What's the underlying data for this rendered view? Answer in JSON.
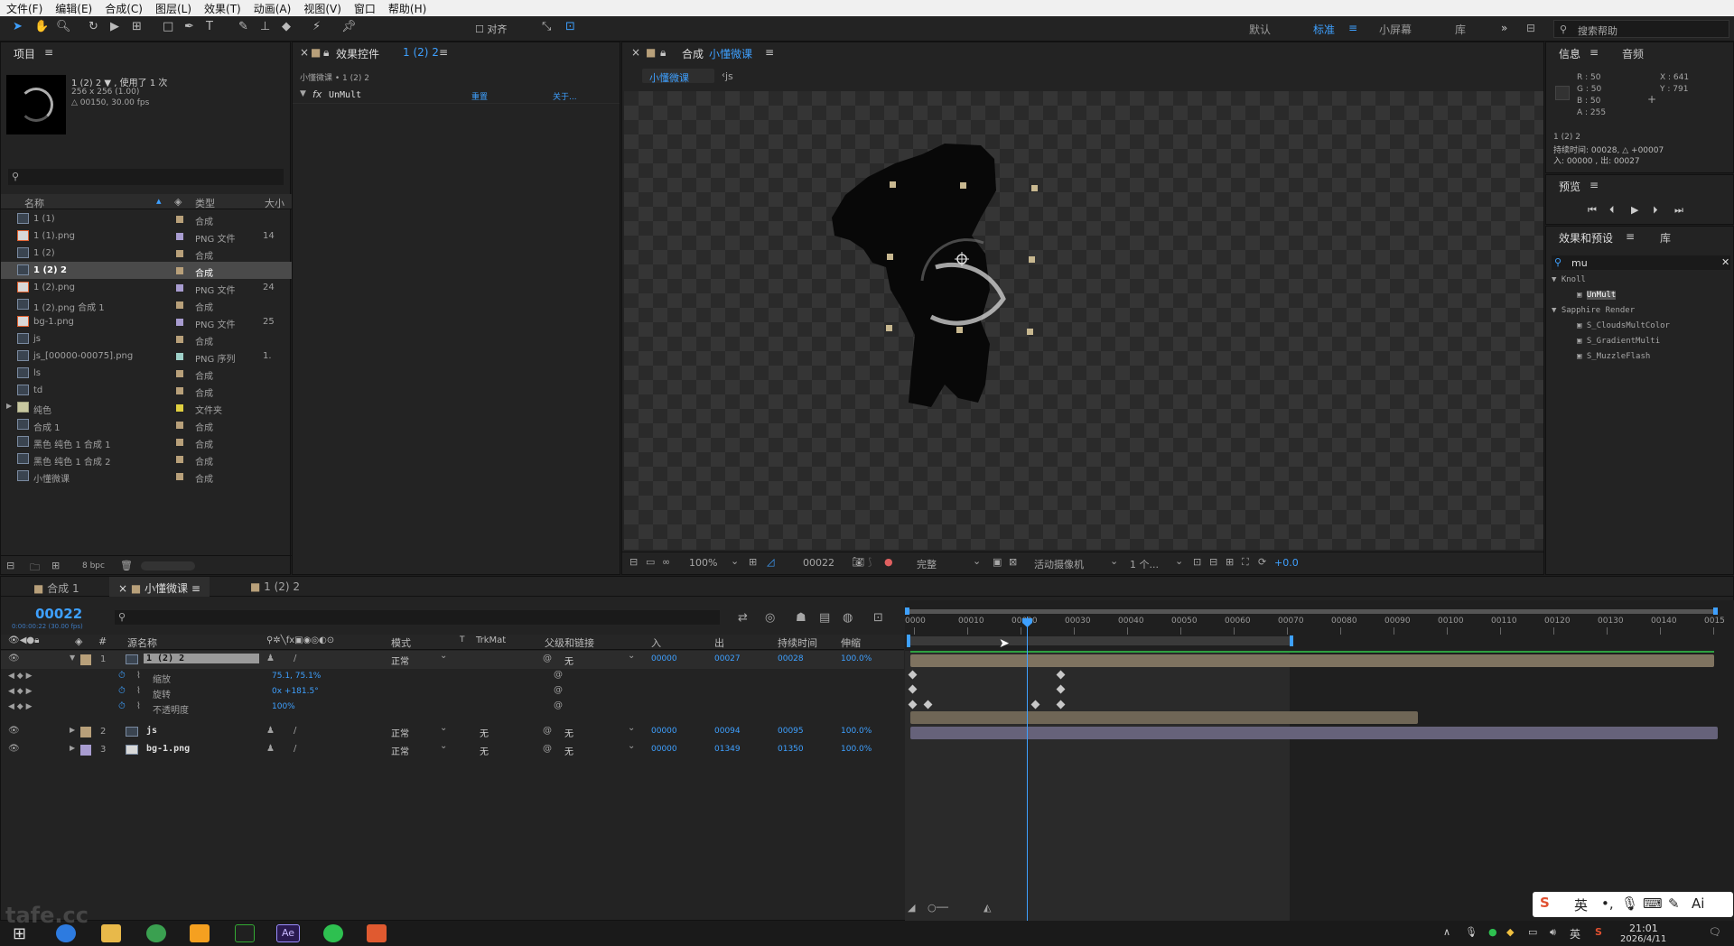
{
  "menu": [
    "文件(F)",
    "编辑(E)",
    "合成(C)",
    "图层(L)",
    "效果(T)",
    "动画(A)",
    "视图(V)",
    "窗口",
    "帮助(H)"
  ],
  "toolbar": {
    "align_label": "对齐",
    "workspaces": [
      "默认",
      "标准",
      "小屏幕",
      "库"
    ],
    "active_workspace": "标准",
    "search_placeholder": "搜索帮助"
  },
  "project": {
    "title": "项目",
    "preview_name": "1 (2) 2 ▼ , 使用了 1 次",
    "preview_size": "256 x 256 (1.00)",
    "preview_fps": "△ 00150, 30.00 fps",
    "col_name": "名称",
    "col_type": "类型",
    "col_size": "大小",
    "bpc": "8 bpc",
    "items": [
      {
        "name": "1 (1)",
        "type": "合成",
        "size": "",
        "color": "#b8a07a",
        "icon": "comp"
      },
      {
        "name": "1 (1).png",
        "type": "PNG 文件",
        "size": "14",
        "color": "#a89cd0",
        "icon": "png"
      },
      {
        "name": "1 (2)",
        "type": "合成",
        "size": "",
        "color": "#b8a07a",
        "icon": "comp"
      },
      {
        "name": "1 (2) 2",
        "type": "合成",
        "size": "",
        "color": "#b8a07a",
        "icon": "comp",
        "selected": true
      },
      {
        "name": "1 (2).png",
        "type": "PNG 文件",
        "size": "24",
        "color": "#a89cd0",
        "icon": "png"
      },
      {
        "name": "1 (2).png 合成 1",
        "type": "合成",
        "size": "",
        "color": "#b8a07a",
        "icon": "comp"
      },
      {
        "name": "bg-1.png",
        "type": "PNG 文件",
        "size": "25",
        "color": "#a89cd0",
        "icon": "png"
      },
      {
        "name": "js",
        "type": "合成",
        "size": "",
        "color": "#b8a07a",
        "icon": "comp"
      },
      {
        "name": "js_[00000-00075].png",
        "type": "PNG 序列",
        "size": "1.",
        "color": "#9ed0c8",
        "icon": "seq"
      },
      {
        "name": "ls",
        "type": "合成",
        "size": "",
        "color": "#b8a07a",
        "icon": "comp"
      },
      {
        "name": "td",
        "type": "合成",
        "size": "",
        "color": "#b8a07a",
        "icon": "comp"
      },
      {
        "name": "纯色",
        "type": "文件夹",
        "size": "",
        "color": "#e0d040",
        "icon": "folder"
      },
      {
        "name": "合成 1",
        "type": "合成",
        "size": "",
        "color": "#b8a07a",
        "icon": "comp"
      },
      {
        "name": "黑色 纯色 1 合成 1",
        "type": "合成",
        "size": "",
        "color": "#b8a07a",
        "icon": "comp"
      },
      {
        "name": "黑色 纯色 1 合成 2",
        "type": "合成",
        "size": "",
        "color": "#b8a07a",
        "icon": "comp"
      },
      {
        "name": "小懂微课",
        "type": "合成",
        "size": "",
        "color": "#b8a07a",
        "icon": "comp"
      }
    ]
  },
  "effects": {
    "tab": "效果控件",
    "tab_target": "1 (2) 2",
    "crumb": "小懂微课 • 1 (2) 2",
    "fx_name": "UnMult",
    "reset": "重置",
    "about": "关于..."
  },
  "composition": {
    "tab": "合成",
    "tab_name": "小懂微课",
    "crumb_active": "小懂微课",
    "crumb_next": "js",
    "zoom": "100%",
    "timecode": "00022",
    "quality": "完整",
    "camera": "活动摄像机",
    "views": "1 个...",
    "exposure": "+0.0"
  },
  "info": {
    "tab": "信息",
    "tab2": "音频",
    "r": "R : 50",
    "g": "G : 50",
    "b": "B : 50",
    "a": "A : 255",
    "x": "X : 641",
    "y": "Y : 791",
    "layer": "1 (2) 2",
    "duration": "持续时间: 00028, △ +00007",
    "inout": "入: 00000 , 出: 00027"
  },
  "preview": {
    "title": "预览"
  },
  "effects_presets": {
    "title": "效果和预设",
    "tab2": "库",
    "search": "mu",
    "groups": [
      {
        "name": "Knoll",
        "items": [
          "UnMult"
        ]
      },
      {
        "name": "Sapphire Render",
        "items": [
          "S_CloudsMultColor",
          "S_GradientMulti",
          "S_MuzzleFlash"
        ]
      }
    ]
  },
  "timeline": {
    "tabs": [
      "合成 1",
      "小懂微课",
      "1 (2) 2"
    ],
    "active_tab": "小懂微课",
    "timecode": "00022",
    "timecode_sub": "0:00:00:22 (30.00 fps)",
    "headers": {
      "source": "源名称",
      "mode": "模式",
      "t": "T",
      "trkmat": "TrkMat",
      "parent": "父级和链接",
      "in": "入",
      "out": "出",
      "duration": "持续时间",
      "stretch": "伸缩"
    },
    "ruler": [
      "0000",
      "00010",
      "00020",
      "00030",
      "00040",
      "00050",
      "00060",
      "00070",
      "00080",
      "00090",
      "00100",
      "00110",
      "00120",
      "00130",
      "00140",
      "0015"
    ],
    "layers": [
      {
        "num": "1",
        "name": "1 (2) 2",
        "mode": "正常",
        "trkmat": "",
        "parent": "无",
        "in": "00000",
        "out": "00027",
        "dur": "00028",
        "stretch": "100.0%",
        "color": "#b8a07a"
      },
      {
        "num": "2",
        "name": "js",
        "mode": "正常",
        "trkmat": "无",
        "parent": "无",
        "in": "00000",
        "out": "00094",
        "dur": "00095",
        "stretch": "100.0%",
        "color": "#b8a07a"
      },
      {
        "num": "3",
        "name": "bg-1.png",
        "mode": "正常",
        "trkmat": "无",
        "parent": "无",
        "in": "00000",
        "out": "01349",
        "dur": "01350",
        "stretch": "100.0%",
        "color": "#a89cd0"
      }
    ],
    "props": [
      {
        "name": "缩放",
        "value": "75.1, 75.1%"
      },
      {
        "name": "旋转",
        "value": "0x +181.5°"
      },
      {
        "name": "不透明度",
        "value": "100%"
      }
    ]
  },
  "taskbar": {
    "ime": "英",
    "time": "21:01",
    "date": "2026/4/11"
  },
  "watermark": "tafe.cc"
}
